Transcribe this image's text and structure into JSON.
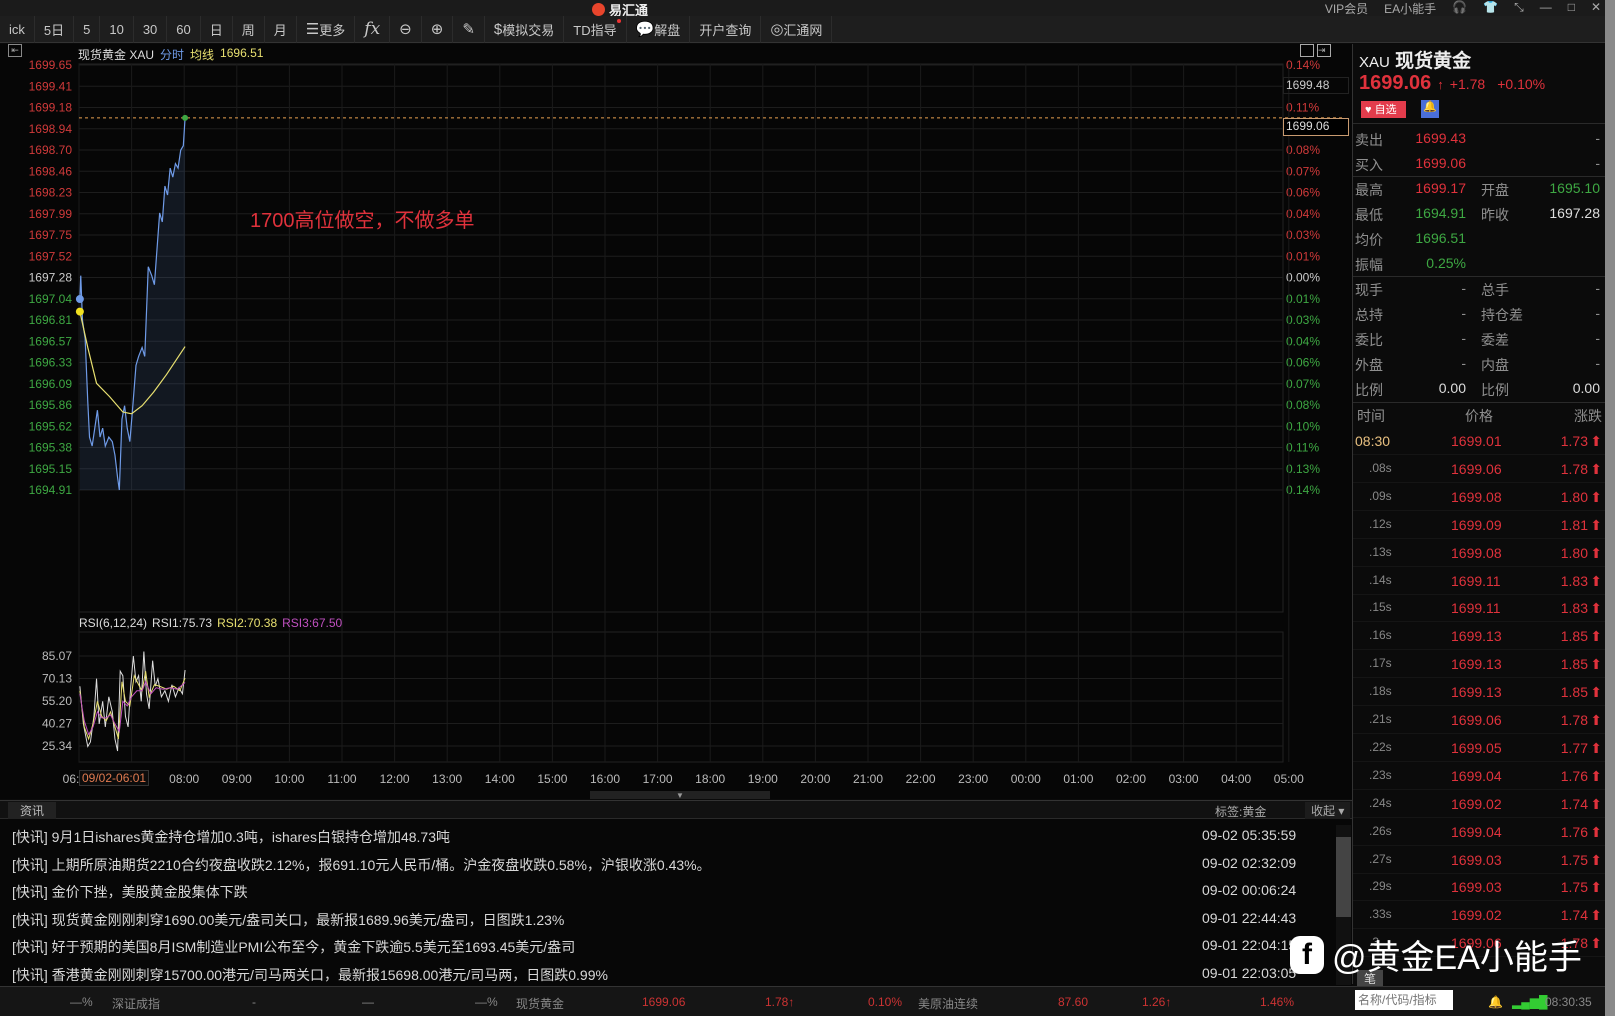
{
  "app": {
    "title": "易汇通",
    "vip": "VIP会员",
    "user": "EA小能手"
  },
  "toolbar": [
    "ick",
    "5日",
    "5",
    "10",
    "30",
    "60",
    "日",
    "周",
    "月",
    "更多",
    "fx",
    "",
    "",
    "",
    "模拟交易",
    "TD指导",
    "解盘",
    "开户查询",
    "汇通网"
  ],
  "chart": {
    "name": "现货黄金 XAU",
    "mode": "分时",
    "avg_label": "均线",
    "avg_value": "1696.51",
    "annotation": "1700高位做空，不做多单",
    "price_box_high": "1699.48",
    "price_box_last": "1699.06",
    "time_marker": "09/02-06:01"
  },
  "chart_data": [
    {
      "type": "line",
      "title": "现货黄金 XAU 分时",
      "ylim": [
        1694.91,
        1699.65
      ],
      "y_ticks": [
        "1699.65",
        "1699.41",
        "1699.18",
        "1698.94",
        "1698.70",
        "1698.46",
        "1698.23",
        "1697.99",
        "1697.75",
        "1697.52",
        "1697.28",
        "1697.04",
        "1696.81",
        "1696.57",
        "1696.33",
        "1696.09",
        "1695.86",
        "1695.62",
        "1695.38",
        "1695.15",
        "1694.91"
      ],
      "pct_ticks": [
        "0.14%",
        "",
        "0.11%",
        "",
        "0.08%",
        "0.07%",
        "0.06%",
        "0.04%",
        "0.03%",
        "0.01%",
        "0.00%",
        "0.01%",
        "0.03%",
        "0.04%",
        "0.06%",
        "0.07%",
        "0.08%",
        "0.10%",
        "0.11%",
        "0.13%",
        "0.14%"
      ],
      "prev_close": 1697.28,
      "x_ticks": [
        "06:",
        "08:00",
        "09:00",
        "10:00",
        "11:00",
        "12:00",
        "13:00",
        "14:00",
        "15:00",
        "16:00",
        "17:00",
        "18:00",
        "19:00",
        "20:00",
        "21:00",
        "22:00",
        "23:00",
        "00:00",
        "01:00",
        "02:00",
        "03:00",
        "04:00",
        "05:00"
      ],
      "x_unit": "minutes since 06:00",
      "x_range": [
        0,
        1380
      ],
      "series": [
        {
          "name": "分时",
          "color": "#6f9be8",
          "points": [
            [
              1,
              1697.04
            ],
            [
              2,
              1697.3
            ],
            [
              4,
              1696.8
            ],
            [
              7,
              1696.6
            ],
            [
              10,
              1695.9
            ],
            [
              12,
              1695.5
            ],
            [
              15,
              1695.4
            ],
            [
              18,
              1695.6
            ],
            [
              21,
              1695.8
            ],
            [
              24,
              1695.5
            ],
            [
              27,
              1695.6
            ],
            [
              30,
              1695.4
            ],
            [
              34,
              1695.5
            ],
            [
              38,
              1695.45
            ],
            [
              41,
              1695.3
            ],
            [
              44,
              1695.05
            ],
            [
              46,
              1694.91
            ],
            [
              49,
              1695.7
            ],
            [
              52,
              1695.85
            ],
            [
              55,
              1695.6
            ],
            [
              58,
              1695.45
            ],
            [
              61,
              1695.8
            ],
            [
              65,
              1696.3
            ],
            [
              68,
              1696.4
            ],
            [
              72,
              1696.5
            ],
            [
              75,
              1696.4
            ],
            [
              79,
              1697.4
            ],
            [
              83,
              1697.3
            ],
            [
              86,
              1697.2
            ],
            [
              89,
              1697.6
            ],
            [
              92,
              1698.0
            ],
            [
              95,
              1697.9
            ],
            [
              98,
              1698.3
            ],
            [
              101,
              1698.2
            ],
            [
              104,
              1698.5
            ],
            [
              107,
              1698.4
            ],
            [
              110,
              1698.55
            ],
            [
              113,
              1698.5
            ],
            [
              116,
              1698.7
            ],
            [
              119,
              1698.75
            ],
            [
              121,
              1699.06
            ]
          ]
        },
        {
          "name": "均线",
          "color": "#e8e070",
          "points": [
            [
              1,
              1696.9
            ],
            [
              10,
              1696.5
            ],
            [
              20,
              1696.1
            ],
            [
              35,
              1695.95
            ],
            [
              50,
              1695.78
            ],
            [
              60,
              1695.76
            ],
            [
              72,
              1695.85
            ],
            [
              85,
              1696.0
            ],
            [
              100,
              1696.2
            ],
            [
              121,
              1696.51
            ]
          ]
        }
      ]
    },
    {
      "type": "line",
      "title": "RSI(6,12,24)",
      "ylim": [
        20,
        92
      ],
      "y_ticks": [
        "85.07",
        "70.13",
        "55.20",
        "40.27",
        "25.34"
      ],
      "legend": [
        {
          "label": "RSI1:75.73",
          "color": "#dddddd"
        },
        {
          "label": "RSI2:70.38",
          "color": "#e8e070"
        },
        {
          "label": "RSI3:67.50",
          "color": "#c050c0"
        }
      ],
      "series": [
        {
          "name": "RSI1",
          "color": "#dddddd",
          "points": [
            [
              1,
              65
            ],
            [
              5,
              40
            ],
            [
              10,
              25
            ],
            [
              13,
              28
            ],
            [
              17,
              45
            ],
            [
              20,
              70
            ],
            [
              23,
              40
            ],
            [
              27,
              55
            ],
            [
              30,
              38
            ],
            [
              34,
              58
            ],
            [
              38,
              48
            ],
            [
              41,
              30
            ],
            [
              44,
              22
            ],
            [
              47,
              75
            ],
            [
              50,
              72
            ],
            [
              53,
              45
            ],
            [
              56,
              38
            ],
            [
              59,
              65
            ],
            [
              62,
              85
            ],
            [
              65,
              68
            ],
            [
              68,
              72
            ],
            [
              71,
              55
            ],
            [
              74,
              88
            ],
            [
              77,
              60
            ],
            [
              80,
              50
            ],
            [
              84,
              82
            ],
            [
              87,
              65
            ],
            [
              90,
              70
            ],
            [
              94,
              58
            ],
            [
              98,
              62
            ],
            [
              102,
              55
            ],
            [
              106,
              66
            ],
            [
              110,
              58
            ],
            [
              114,
              64
            ],
            [
              118,
              60
            ],
            [
              121,
              75.73
            ]
          ]
        },
        {
          "name": "RSI2",
          "color": "#e8e070",
          "points": [
            [
              1,
              62
            ],
            [
              6,
              38
            ],
            [
              11,
              30
            ],
            [
              16,
              40
            ],
            [
              21,
              55
            ],
            [
              26,
              45
            ],
            [
              31,
              42
            ],
            [
              36,
              48
            ],
            [
              41,
              38
            ],
            [
              45,
              30
            ],
            [
              49,
              68
            ],
            [
              53,
              55
            ],
            [
              58,
              52
            ],
            [
              63,
              72
            ],
            [
              68,
              66
            ],
            [
              72,
              62
            ],
            [
              76,
              75
            ],
            [
              80,
              58
            ],
            [
              86,
              66
            ],
            [
              92,
              65
            ],
            [
              100,
              63
            ],
            [
              108,
              65
            ],
            [
              115,
              62
            ],
            [
              121,
              70.38
            ]
          ]
        },
        {
          "name": "RSI3",
          "color": "#c050c0",
          "points": [
            [
              1,
              60
            ],
            [
              6,
              42
            ],
            [
              11,
              33
            ],
            [
              16,
              38
            ],
            [
              21,
              48
            ],
            [
              26,
              44
            ],
            [
              31,
              44
            ],
            [
              36,
              46
            ],
            [
              41,
              40
            ],
            [
              46,
              35
            ],
            [
              50,
              55
            ],
            [
              55,
              52
            ],
            [
              60,
              58
            ],
            [
              66,
              62
            ],
            [
              72,
              62
            ],
            [
              76,
              68
            ],
            [
              82,
              60
            ],
            [
              88,
              64
            ],
            [
              96,
              63
            ],
            [
              104,
              64
            ],
            [
              112,
              63
            ],
            [
              121,
              67.5
            ]
          ]
        }
      ]
    }
  ],
  "quote": {
    "symbol": "XAU",
    "name": "现货黄金",
    "price": "1699.06",
    "arrow": "↑",
    "change": "+1.78",
    "pct": "+0.10%",
    "fav": "自选",
    "rows": [
      {
        "l1": "卖出",
        "v1": "1699.43",
        "c1": "red",
        "l2": "",
        "v2": "-",
        "c2": "grey"
      },
      {
        "l1": "买入",
        "v1": "1699.06",
        "c1": "red",
        "l2": "",
        "v2": "-",
        "c2": "grey"
      },
      {
        "l1": "最高",
        "v1": "1699.17",
        "c1": "red",
        "l2": "开盘",
        "v2": "1695.10",
        "c2": "green"
      },
      {
        "l1": "最低",
        "v1": "1694.91",
        "c1": "green",
        "l2": "昨收",
        "v2": "1697.28",
        "c2": "white"
      },
      {
        "l1": "均价",
        "v1": "1696.51",
        "c1": "green",
        "l2": "",
        "v2": "",
        "c2": "white"
      },
      {
        "l1": "振幅",
        "v1": "0.25%",
        "c1": "green",
        "l2": "",
        "v2": "",
        "c2": "white"
      },
      {
        "l1": "现手",
        "v1": "-",
        "c1": "grey",
        "l2": "总手",
        "v2": "-",
        "c2": "grey"
      },
      {
        "l1": "总持",
        "v1": "-",
        "c1": "grey",
        "l2": "持仓差",
        "v2": "-",
        "c2": "grey"
      },
      {
        "l1": "委比",
        "v1": "-",
        "c1": "grey",
        "l2": "委差",
        "v2": "-",
        "c2": "grey"
      },
      {
        "l1": "外盘",
        "v1": "-",
        "c1": "grey",
        "l2": "内盘",
        "v2": "-",
        "c2": "grey"
      },
      {
        "l1": "比例",
        "v1": "0.00",
        "c1": "white",
        "l2": "比例",
        "v2": "0.00",
        "c2": "white"
      }
    ]
  },
  "ticks": {
    "headers": [
      "时间",
      "价格",
      "涨跌"
    ],
    "tab": "笔",
    "rows": [
      [
        "08:30",
        "1699.01",
        "1.73"
      ],
      [
        ".08s",
        "1699.06",
        "1.78"
      ],
      [
        ".09s",
        "1699.08",
        "1.80"
      ],
      [
        ".12s",
        "1699.09",
        "1.81"
      ],
      [
        ".13s",
        "1699.08",
        "1.80"
      ],
      [
        ".14s",
        "1699.11",
        "1.83"
      ],
      [
        ".15s",
        "1699.11",
        "1.83"
      ],
      [
        ".16s",
        "1699.13",
        "1.85"
      ],
      [
        ".17s",
        "1699.13",
        "1.85"
      ],
      [
        ".18s",
        "1699.13",
        "1.85"
      ],
      [
        ".21s",
        "1699.06",
        "1.78"
      ],
      [
        ".22s",
        "1699.05",
        "1.77"
      ],
      [
        ".23s",
        "1699.04",
        "1.76"
      ],
      [
        ".24s",
        "1699.02",
        "1.74"
      ],
      [
        ".26s",
        "1699.04",
        "1.76"
      ],
      [
        ".27s",
        "1699.03",
        "1.75"
      ],
      [
        ".29s",
        "1699.03",
        "1.75"
      ],
      [
        ".33s",
        "1699.02",
        "1.74"
      ],
      [
        ".3",
        "1699.06",
        "1.78"
      ]
    ]
  },
  "news": {
    "tab": "资讯",
    "tag": "标签:黄金",
    "collapse": "收起",
    "items": [
      {
        "text": "[快讯] 9月1日ishares黄金持仓增加0.3吨，ishares白银持仓增加48.73吨",
        "time": "09-02 05:35:59"
      },
      {
        "text": "[快讯] 上期所原油期货2210合约夜盘收跌2.12%，报691.10元人民币/桶。沪金夜盘收跌0.58%，沪银收涨0.43%。",
        "time": "09-02 02:32:09"
      },
      {
        "text": "[快讯] 金价下挫，美股黄金股集体下跌",
        "time": "09-02 00:06:24"
      },
      {
        "text": "[快讯] 现货黄金刚刚刺穿1690.00美元/盎司关口，最新报1689.96美元/盎司，日图跌1.23%",
        "time": "09-01 22:44:43"
      },
      {
        "text": "[快讯] 好于预期的美国8月ISM制造业PMI公布至今，黄金下跌逾5.5美元至1693.45美元/盎司",
        "time": "09-01 22:04:15"
      },
      {
        "text": "[快讯] 香港黄金刚刚刺穿15700.00港元/司马两关口，最新报15698.00港元/司马两，日图跌0.99%",
        "time": "09-01 22:03:05"
      }
    ]
  },
  "status": {
    "a": "—%",
    "b": "深证成指",
    "c": "-",
    "d": "—",
    "e": "—%",
    "f": "现货黄金",
    "g": "1699.06",
    "h": "1.78↑",
    "i": "0.10%",
    "j": "美原油连续",
    "k": "87.60",
    "l": "1.26↑",
    "m": "1.46%",
    "search_placeholder": "名称/代码/指标",
    "clock": "08:30:35"
  },
  "watermark": "@黄金EA小能手"
}
